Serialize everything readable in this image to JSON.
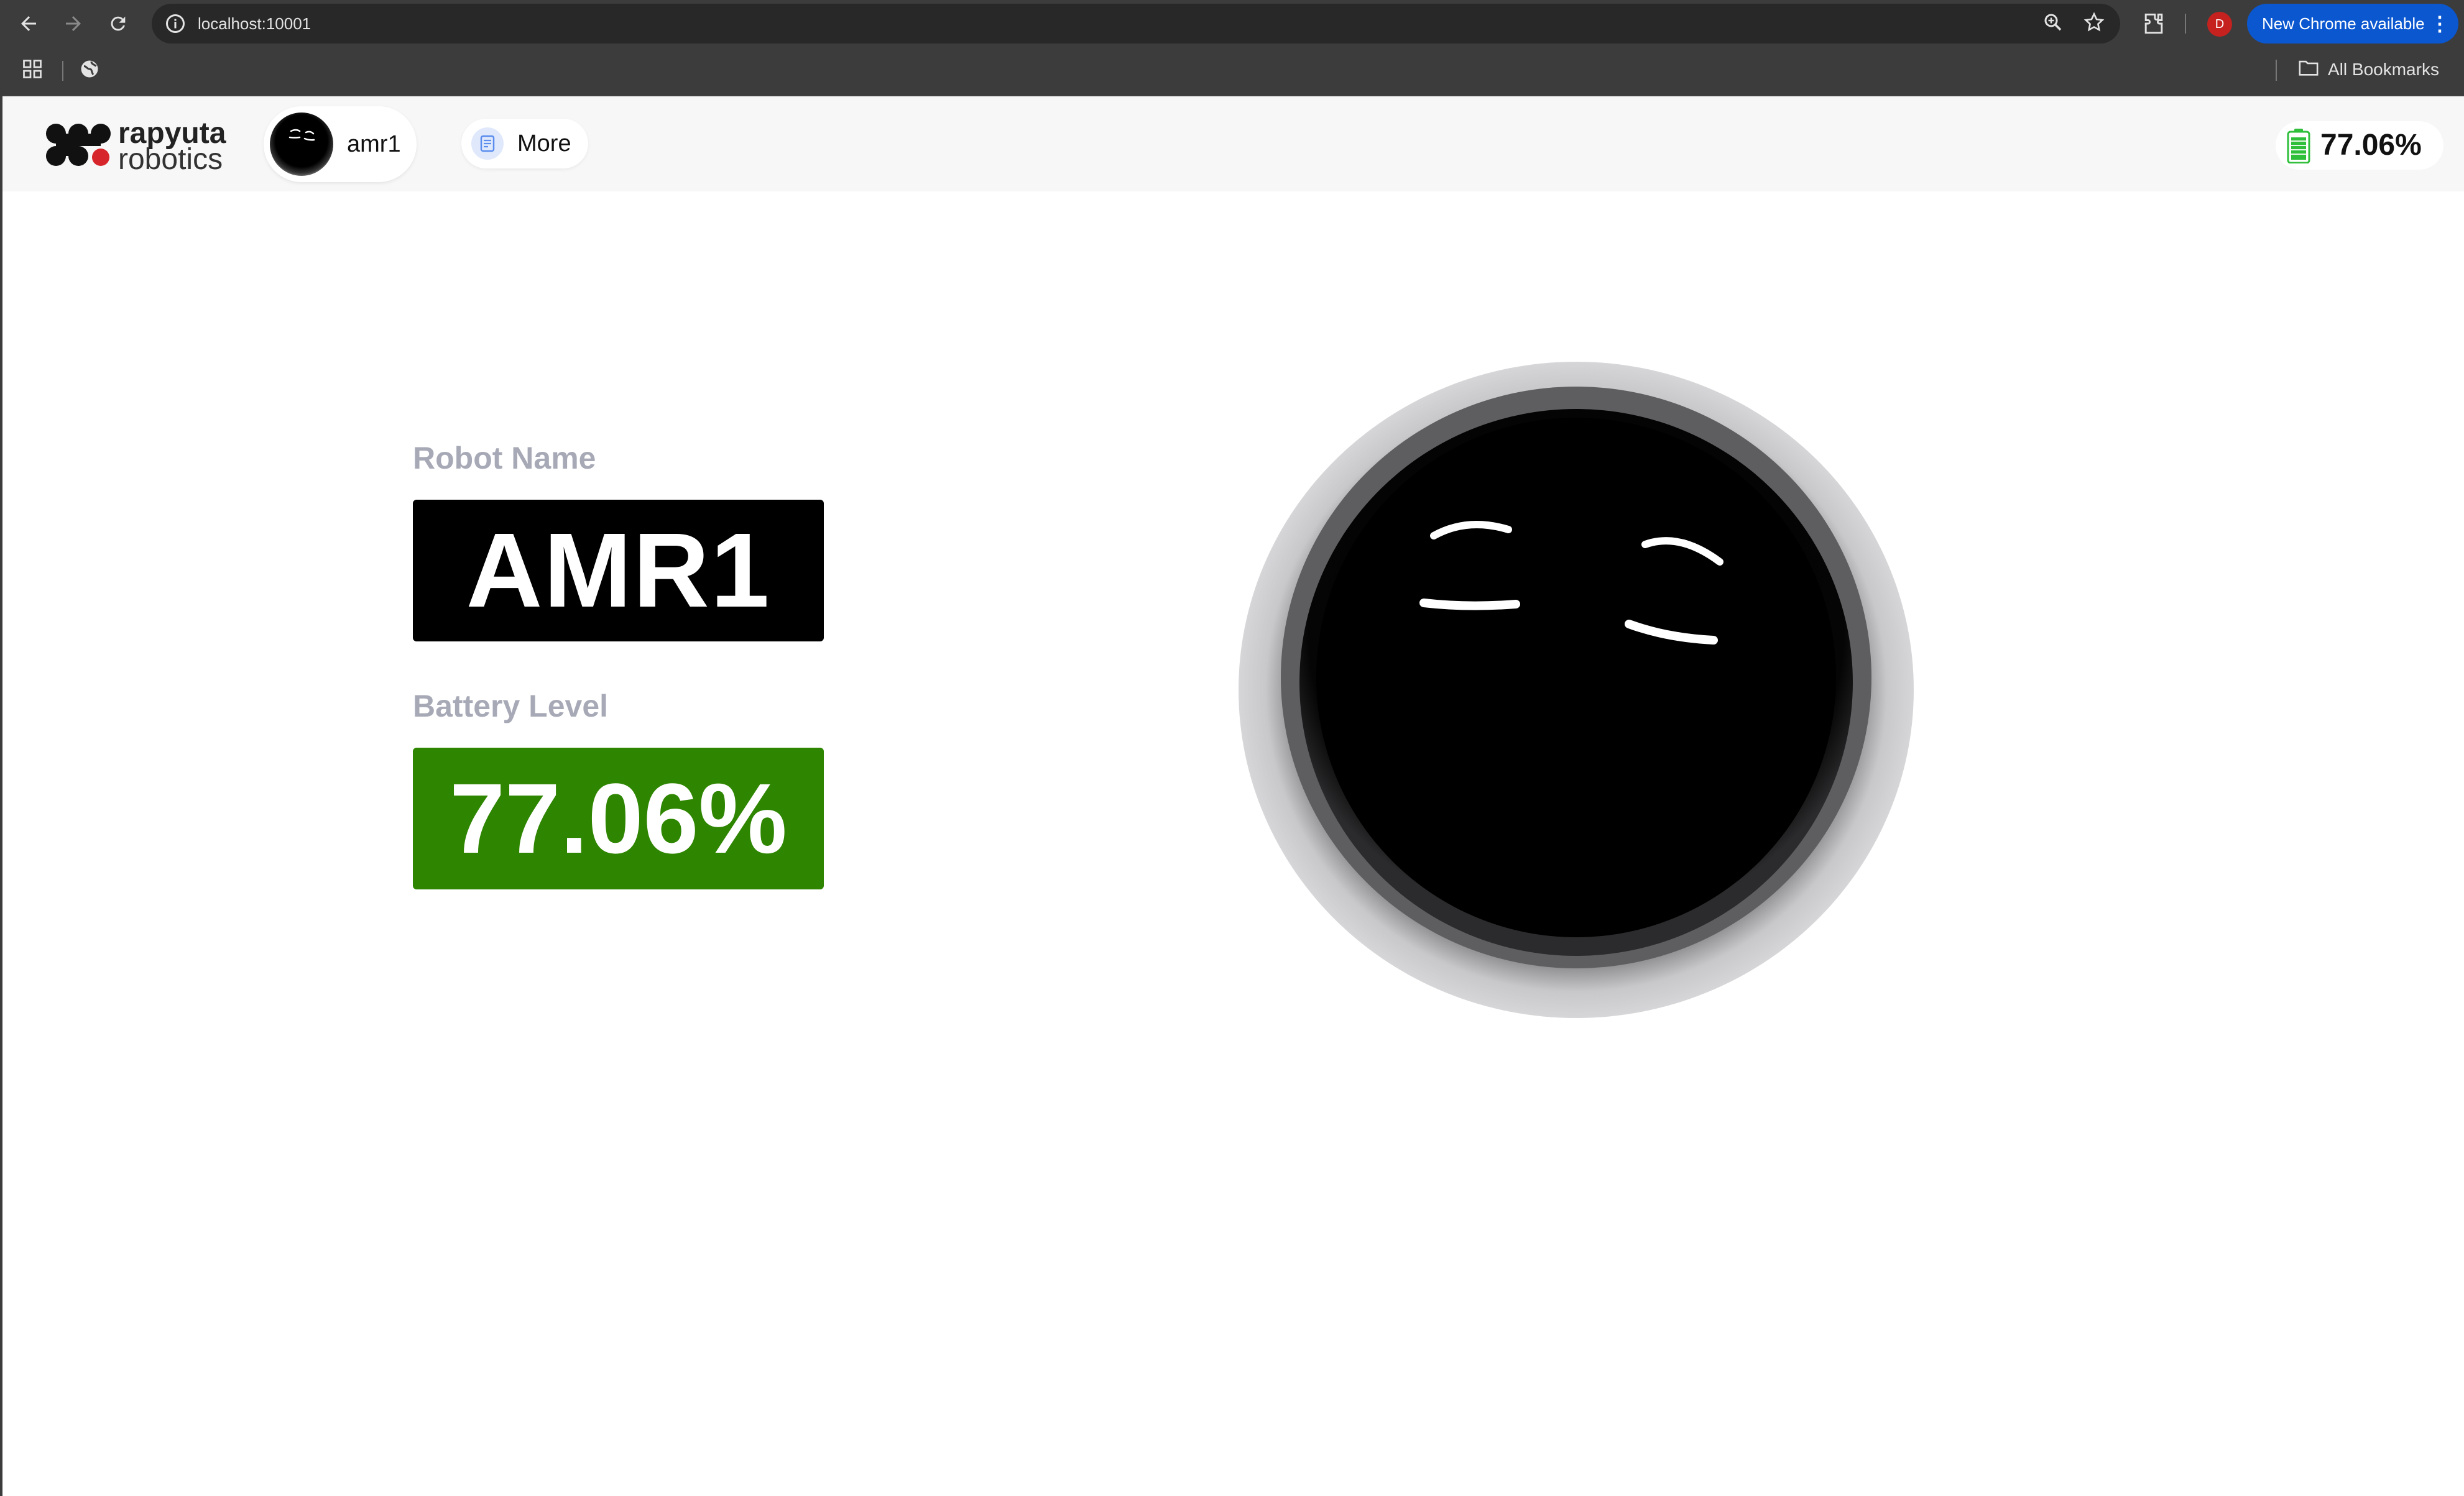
{
  "browser": {
    "url": "localhost:10001",
    "update_label": "New Chrome available",
    "bookmarks_label": "All Bookmarks",
    "profile_initial": "D"
  },
  "header": {
    "logo_line1": "rapyuta",
    "logo_line2": "robotics",
    "robot_name": "amr1",
    "more_label": "More",
    "battery_text": "77.06%"
  },
  "main": {
    "robot_name_label": "Robot Name",
    "robot_name_value": "AMR1",
    "battery_label": "Battery Level",
    "battery_value": "77.06%",
    "battery_level": 0.7706
  },
  "colors": {
    "battery_green": "#2e8500",
    "header_bg": "#f7f7f7",
    "chrome_dark": "#3c3c3c",
    "accent_blue": "#0b57d0"
  },
  "icons": [
    "back-arrow-icon",
    "forward-arrow-icon",
    "reload-icon",
    "site-info-icon",
    "zoom-icon",
    "star-icon",
    "extensions-icon",
    "apps-grid-icon",
    "globe-icon",
    "folder-icon",
    "document-icon",
    "battery-icon",
    "robot-face-icon"
  ]
}
